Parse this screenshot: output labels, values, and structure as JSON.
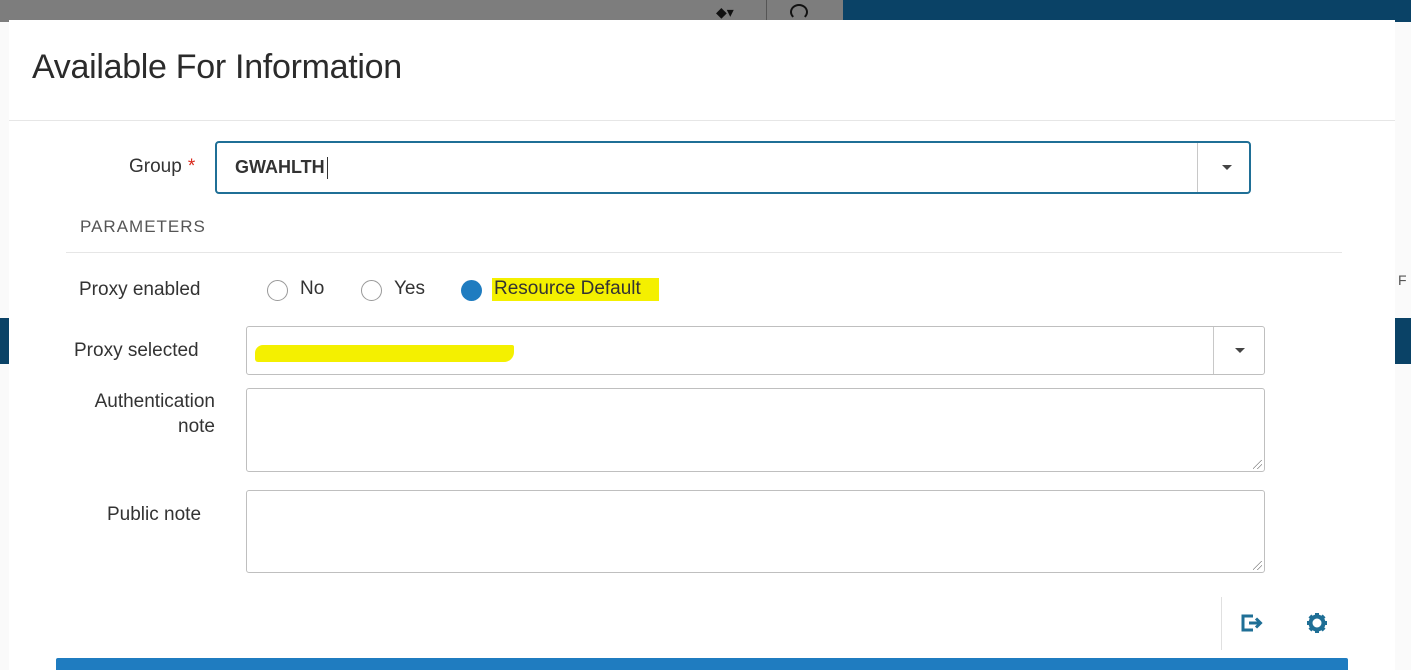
{
  "modal": {
    "title": "Available For Information"
  },
  "group": {
    "label": "Group",
    "required_mark": "*",
    "value": "GWAHLTH"
  },
  "parameters": {
    "section_title": "PARAMETERS",
    "proxy_enabled": {
      "label": "Proxy enabled",
      "options": [
        "No",
        "Yes",
        "Resource Default"
      ],
      "selected": "Resource Default"
    },
    "proxy_selected": {
      "label": "Proxy selected",
      "value": ""
    },
    "authentication_note": {
      "label_line1": "Authentication",
      "label_line2": "note",
      "value": ""
    },
    "public_note": {
      "label": "Public note",
      "value": ""
    }
  },
  "footer": {
    "icons": [
      "sign-out-icon",
      "gear-icon"
    ]
  },
  "colors": {
    "accent": "#1f7cc0",
    "header_dark": "#0a4266",
    "highlight": "#f4f000",
    "required": "#d9291c"
  }
}
